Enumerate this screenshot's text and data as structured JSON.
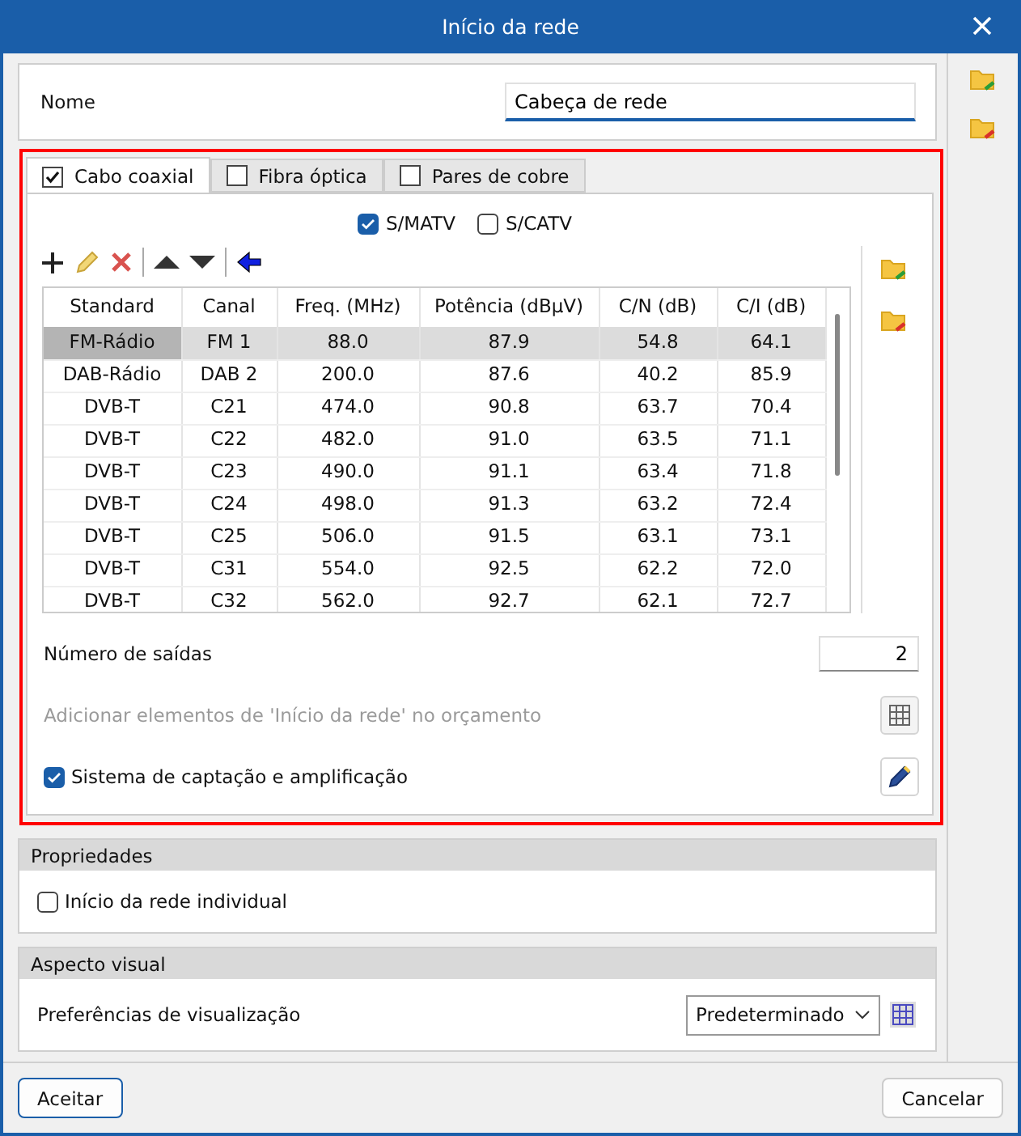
{
  "window": {
    "title": "Início da rede"
  },
  "name_field": {
    "label": "Nome",
    "value": "Cabeça de rede"
  },
  "tabs": [
    {
      "label": "Cabo coaxial",
      "checked": true,
      "selected": true
    },
    {
      "label": "Fibra óptica",
      "checked": false,
      "selected": false
    },
    {
      "label": "Pares de cobre",
      "checked": false,
      "selected": false
    }
  ],
  "modes": [
    {
      "label": "S/MATV",
      "checked": true
    },
    {
      "label": "S/CATV",
      "checked": false
    }
  ],
  "table": {
    "columns": [
      "Standard",
      "Canal",
      "Freq. (MHz)",
      "Potência (dBµV)",
      "C/N (dB)",
      "C/I (dB)"
    ],
    "rows": [
      {
        "cells": [
          "FM-Rádio",
          "FM 1",
          "88.0",
          "87.9",
          "54.8",
          "64.1"
        ],
        "selected": true
      },
      {
        "cells": [
          "DAB-Rádio",
          "DAB 2",
          "200.0",
          "87.6",
          "40.2",
          "85.9"
        ],
        "selected": false
      },
      {
        "cells": [
          "DVB-T",
          "C21",
          "474.0",
          "90.8",
          "63.7",
          "70.4"
        ],
        "selected": false
      },
      {
        "cells": [
          "DVB-T",
          "C22",
          "482.0",
          "91.0",
          "63.5",
          "71.1"
        ],
        "selected": false
      },
      {
        "cells": [
          "DVB-T",
          "C23",
          "490.0",
          "91.1",
          "63.4",
          "71.8"
        ],
        "selected": false
      },
      {
        "cells": [
          "DVB-T",
          "C24",
          "498.0",
          "91.3",
          "63.2",
          "72.4"
        ],
        "selected": false
      },
      {
        "cells": [
          "DVB-T",
          "C25",
          "506.0",
          "91.5",
          "63.1",
          "73.1"
        ],
        "selected": false
      },
      {
        "cells": [
          "DVB-T",
          "C31",
          "554.0",
          "92.5",
          "62.2",
          "72.0"
        ],
        "selected": false
      },
      {
        "cells": [
          "DVB-T",
          "C32",
          "562.0",
          "92.7",
          "62.1",
          "72.7"
        ],
        "selected": false
      }
    ]
  },
  "outputs": {
    "label": "Número de saídas",
    "value": "2"
  },
  "budget": {
    "label": "Adicionar elementos de 'Início da rede' no orçamento",
    "disabled": true
  },
  "system": {
    "label": "Sistema de captação e amplificação",
    "checked": true
  },
  "properties": {
    "title": "Propriedades",
    "checkbox": {
      "label": "Início da rede individual",
      "checked": false
    }
  },
  "visual": {
    "title": "Aspecto visual",
    "label": "Preferências de visualização",
    "value": "Predeterminado"
  },
  "buttons": [
    {
      "label": "Aceitar",
      "kind": "primary"
    },
    {
      "label": "Cancelar",
      "kind": "normal"
    }
  ]
}
